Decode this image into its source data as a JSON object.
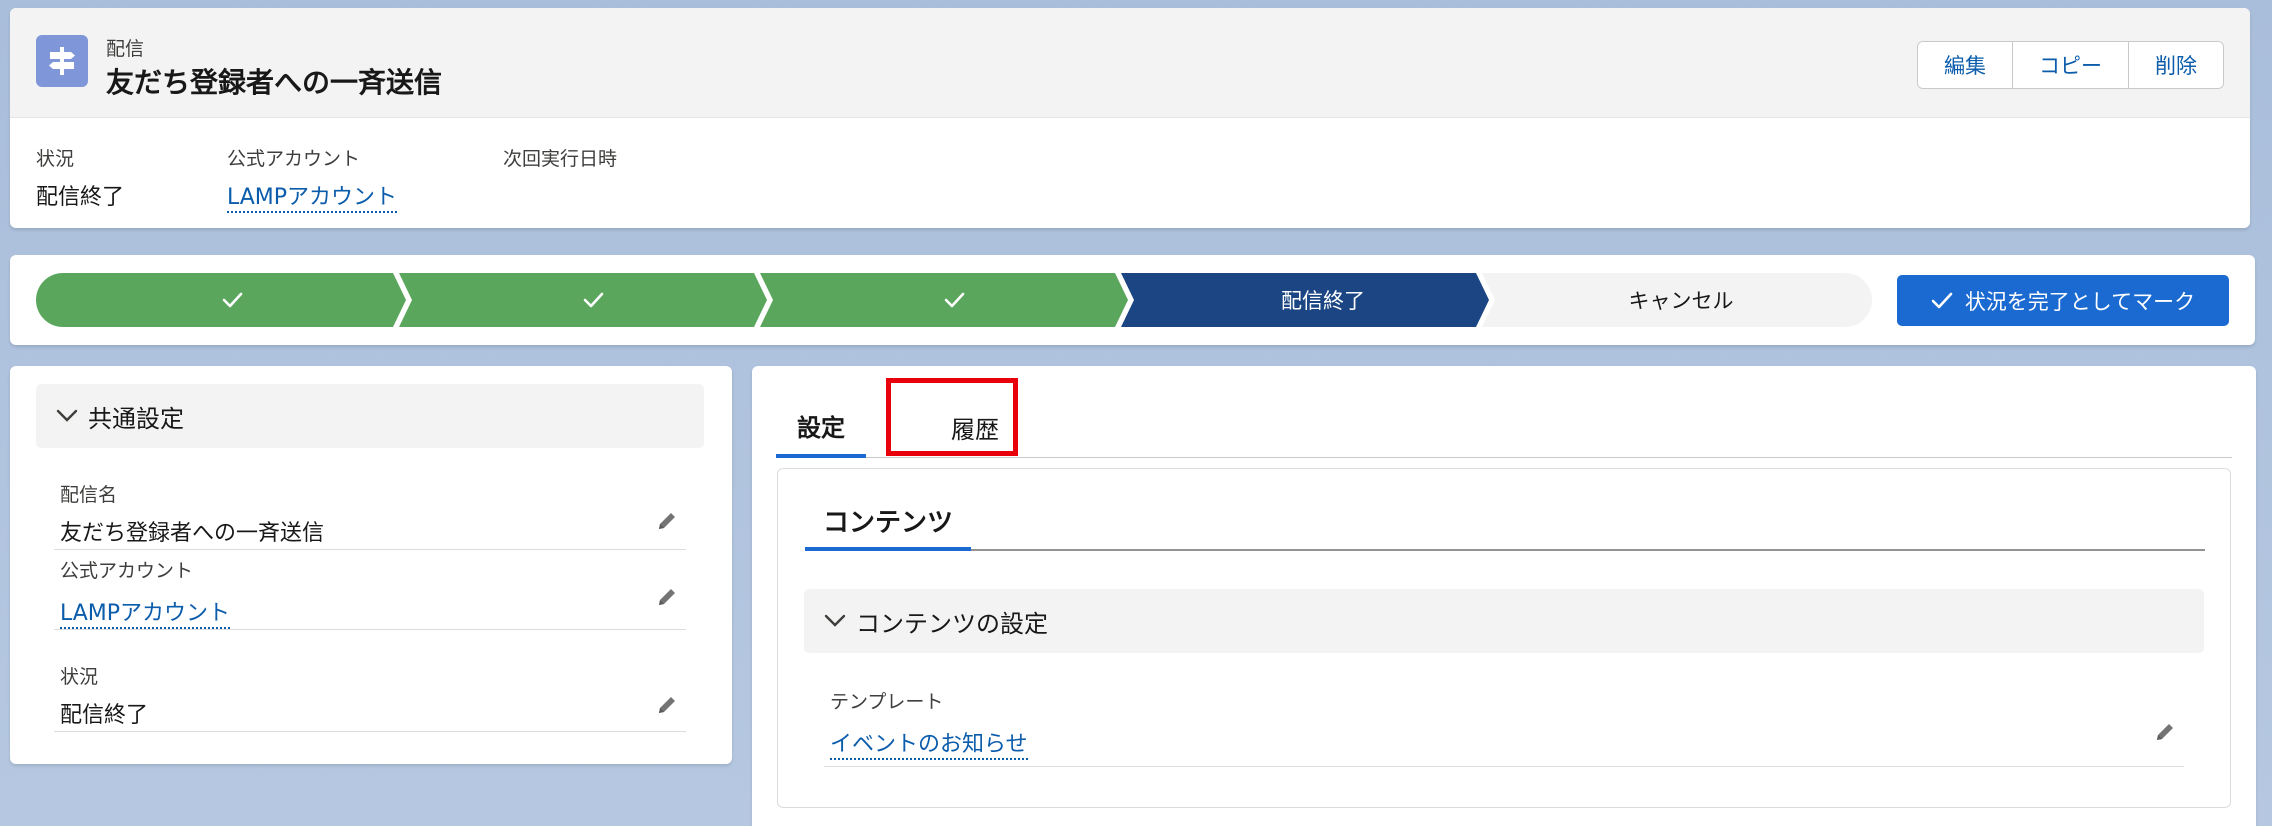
{
  "header": {
    "object_label": "配信",
    "title": "友だち登録者への一斉送信",
    "buttons": {
      "edit": "編集",
      "copy": "コピー",
      "delete": "削除"
    },
    "highlights": {
      "status_label": "状況",
      "status_value": "配信終了",
      "account_label": "公式アカウント",
      "account_value": "LAMPアカウント",
      "next_run_label": "次回実行日時"
    }
  },
  "path": {
    "steps": [
      {
        "state": "complete"
      },
      {
        "state": "complete"
      },
      {
        "state": "complete"
      },
      {
        "state": "current",
        "label": "配信終了"
      },
      {
        "state": "incomplete",
        "label": "キャンセル"
      }
    ],
    "mark_complete_label": "状況を完了としてマーク"
  },
  "left_panel": {
    "section_title": "共通設定",
    "fields": {
      "name_label": "配信名",
      "name_value": "友だち登録者への一斉送信",
      "account_label": "公式アカウント",
      "account_value": "LAMPアカウント",
      "status_label": "状況",
      "status_value": "配信終了"
    }
  },
  "right_panel": {
    "tabs": {
      "settings": "設定",
      "history": "履歴"
    },
    "inner_tab": "コンテンツ",
    "section_title": "コンテンツの設定",
    "template_label": "テンプレート",
    "template_value": "イベントのお知らせ"
  },
  "colors": {
    "path_complete": "#5ba65d",
    "path_current": "#1b4683",
    "path_incomplete": "#f3f3f3",
    "brand_blue": "#1b6ad1",
    "link": "#0b5cab",
    "highlight_red": "#e8000b"
  }
}
